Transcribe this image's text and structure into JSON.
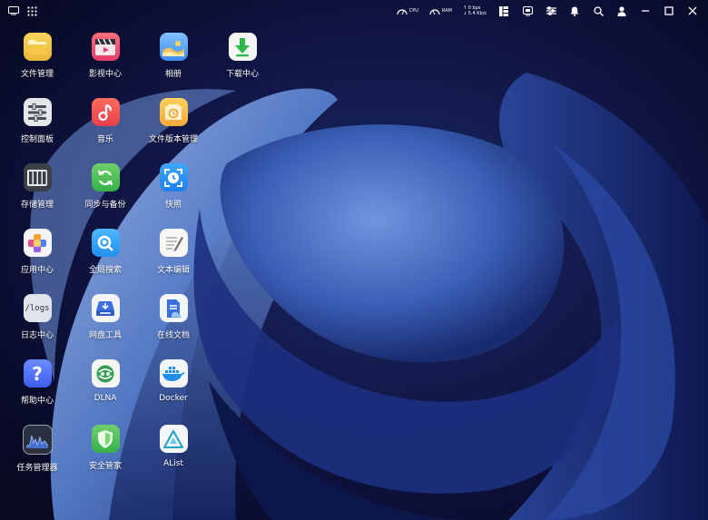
{
  "topbar": {
    "left_icons": [
      "desktop-icon",
      "apps-grid-icon"
    ],
    "net_labels": [
      "CPU",
      "RAM"
    ],
    "upload_speed": "↑ 0 bps",
    "download_speed": "↓ 5.4 Kb/s",
    "right_icons": [
      "widget-panel-icon",
      "monitor-icon",
      "sliders-icon",
      "bell-icon",
      "search-icon",
      "user-icon",
      "minimize-icon",
      "maximize-icon",
      "close-icon"
    ]
  },
  "apps": [
    {
      "label": "文件管理",
      "icon": "folder-icon"
    },
    {
      "label": "影视中心",
      "icon": "video-icon"
    },
    {
      "label": "相册",
      "icon": "photo-icon"
    },
    {
      "label": "下载中心",
      "icon": "download-icon"
    },
    {
      "label": "控制面板",
      "icon": "control-panel-icon"
    },
    {
      "label": "音乐",
      "icon": "music-icon"
    },
    {
      "label": "文件版本管理",
      "icon": "file-version-icon"
    },
    {
      "label": "存储管理",
      "icon": "storage-icon"
    },
    {
      "label": "同步与备份",
      "icon": "sync-icon"
    },
    {
      "label": "快照",
      "icon": "snapshot-icon"
    },
    {
      "label": "应用中心",
      "icon": "app-center-icon"
    },
    {
      "label": "全局搜索",
      "icon": "global-search-icon"
    },
    {
      "label": "文本编辑",
      "icon": "text-editor-icon"
    },
    {
      "label": "日志中心",
      "icon": "logs-icon",
      "icon_text": "/logs"
    },
    {
      "label": "网盘工具",
      "icon": "cloud-drive-icon"
    },
    {
      "label": "在线文档",
      "icon": "online-doc-icon"
    },
    {
      "label": "帮助中心",
      "icon": "help-icon",
      "icon_text": "?"
    },
    {
      "label": "DLNA",
      "icon": "dlna-icon"
    },
    {
      "label": "Docker",
      "icon": "docker-icon"
    },
    {
      "label": "任务管理器",
      "icon": "task-manager-icon"
    },
    {
      "label": "安全管家",
      "icon": "security-icon"
    },
    {
      "label": "AList",
      "icon": "alist-icon"
    }
  ],
  "colors": {
    "background": "#0b0c2e",
    "petal_light": "#8fb0ea",
    "petal_mid": "#4a72c4",
    "petal_dark": "#1a2c6e"
  }
}
